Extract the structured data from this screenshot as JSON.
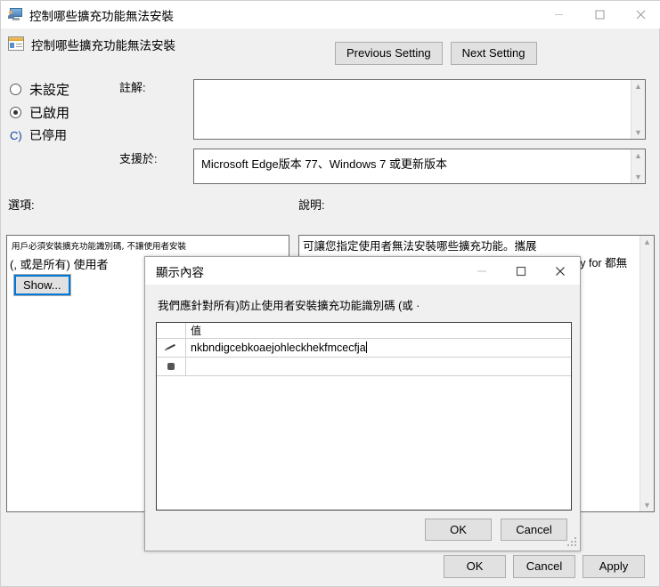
{
  "window": {
    "title": "控制哪些擴充功能無法安裝",
    "icon": "monitor-user-icon",
    "minimize_label": "—",
    "maximize_label": "□",
    "close_label": "✕"
  },
  "header": {
    "title": "控制哪些擴充功能無法安裝",
    "icon": "policy-setting-icon",
    "previous_setting_label": "Previous Setting",
    "next_setting_label": "Next Setting"
  },
  "state_radios": [
    {
      "label": "未設定",
      "selected": false,
      "glyph": ""
    },
    {
      "label": "已啟用",
      "selected": true,
      "glyph": ""
    },
    {
      "label": "已停用",
      "selected": false,
      "glyph": "C)"
    }
  ],
  "fields": {
    "comment_label": "註解:",
    "comment_value": "",
    "supported_label": "支援於:",
    "supported_value": "Microsoft Edge版本 77、Windows 7 或更新版本"
  },
  "options": {
    "label": "選項:",
    "note": "用戶必須安裝擴充功能識別碼, 不讓使用者安裝",
    "sub": "(, 或是所有) 使用者",
    "show_button_label": "Show..."
  },
  "help": {
    "label": "說明:",
    "text": "可讓您指定使用者無法安裝哪些擴充功能。攜展\nalready installed will be disabled if blocked, without a way for 都無法安\n\nthe\n\n\nss 裝擴充功能\n\nc標識碼。"
  },
  "footer": {
    "ok_label": "OK",
    "cancel_label": "Cancel",
    "apply_label": "Apply"
  },
  "child_dialog": {
    "title": "顯示內容",
    "minimize_label": "—",
    "maximize_label": "□",
    "close_label": "✕",
    "prompt": "我們應針對所有)防止使用者安裝擴充功能識別碼 (或 ·",
    "grid": {
      "column_header": "值",
      "rows": [
        {
          "row_icon": "pencil-icon",
          "value": "nkbndigcebkoaejohleckhekfmcecfja",
          "editing": true
        },
        {
          "row_icon": "asterisk-icon",
          "value": "",
          "editing": false
        }
      ]
    },
    "ok_label": "OK",
    "cancel_label": "Cancel"
  },
  "colors": {
    "window_background": "#f0f0f0",
    "titlebar": "#ffffff",
    "button_face": "#e1e1e1",
    "button_border": "#adadad",
    "focus_ring": "#0078d7",
    "field_border": "#6d6d6d"
  }
}
